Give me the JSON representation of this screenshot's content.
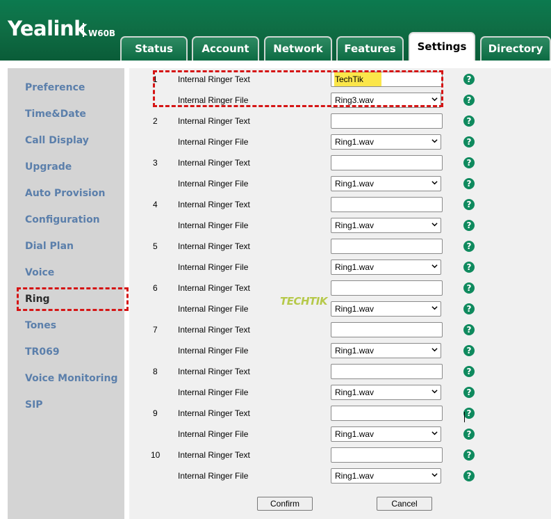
{
  "brand": {
    "logo": "Yealink",
    "model": "W60B"
  },
  "tabs": [
    {
      "label": "Status",
      "active": false
    },
    {
      "label": "Account",
      "active": false
    },
    {
      "label": "Network",
      "active": false
    },
    {
      "label": "Features",
      "active": false
    },
    {
      "label": "Settings",
      "active": true
    },
    {
      "label": "Directory",
      "active": false
    }
  ],
  "sidebar": {
    "items": [
      {
        "label": "Preference"
      },
      {
        "label": "Time&Date"
      },
      {
        "label": "Call Display"
      },
      {
        "label": "Upgrade"
      },
      {
        "label": "Auto Provision"
      },
      {
        "label": "Configuration"
      },
      {
        "label": "Dial Plan"
      },
      {
        "label": "Voice"
      },
      {
        "label": "Ring",
        "active": true
      },
      {
        "label": "Tones"
      },
      {
        "label": "TR069"
      },
      {
        "label": "Voice Monitoring"
      },
      {
        "label": "SIP"
      }
    ]
  },
  "ringers": [
    {
      "num": "1",
      "text_label": "Internal Ringer Text",
      "text_value": "TechTik",
      "file_label": "Internal Ringer File",
      "file_value": "Ring3.wav"
    },
    {
      "num": "2",
      "text_label": "Internal Ringer Text",
      "text_value": "",
      "file_label": "Internal Ringer File",
      "file_value": "Ring1.wav"
    },
    {
      "num": "3",
      "text_label": "Internal Ringer Text",
      "text_value": "",
      "file_label": "Internal Ringer File",
      "file_value": "Ring1.wav"
    },
    {
      "num": "4",
      "text_label": "Internal Ringer Text",
      "text_value": "",
      "file_label": "Internal Ringer File",
      "file_value": "Ring1.wav"
    },
    {
      "num": "5",
      "text_label": "Internal Ringer Text",
      "text_value": "",
      "file_label": "Internal Ringer File",
      "file_value": "Ring1.wav"
    },
    {
      "num": "6",
      "text_label": "Internal Ringer Text",
      "text_value": "",
      "file_label": "Internal Ringer File",
      "file_value": "Ring1.wav"
    },
    {
      "num": "7",
      "text_label": "Internal Ringer Text",
      "text_value": "",
      "file_label": "Internal Ringer File",
      "file_value": "Ring1.wav"
    },
    {
      "num": "8",
      "text_label": "Internal Ringer Text",
      "text_value": "",
      "file_label": "Internal Ringer File",
      "file_value": "Ring1.wav"
    },
    {
      "num": "9",
      "text_label": "Internal Ringer Text",
      "text_value": "",
      "file_label": "Internal Ringer File",
      "file_value": "Ring1.wav"
    },
    {
      "num": "10",
      "text_label": "Internal Ringer Text",
      "text_value": "",
      "file_label": "Internal Ringer File",
      "file_value": "Ring1.wav"
    }
  ],
  "help_glyph": "?",
  "buttons": {
    "confirm": "Confirm",
    "cancel": "Cancel"
  },
  "watermark": "TECHTIK",
  "colors": {
    "brand_green": "#0f6e45",
    "link_blue": "#5b7fab",
    "highlight_red": "#d51515",
    "text_highlight": "#fbe64a"
  }
}
